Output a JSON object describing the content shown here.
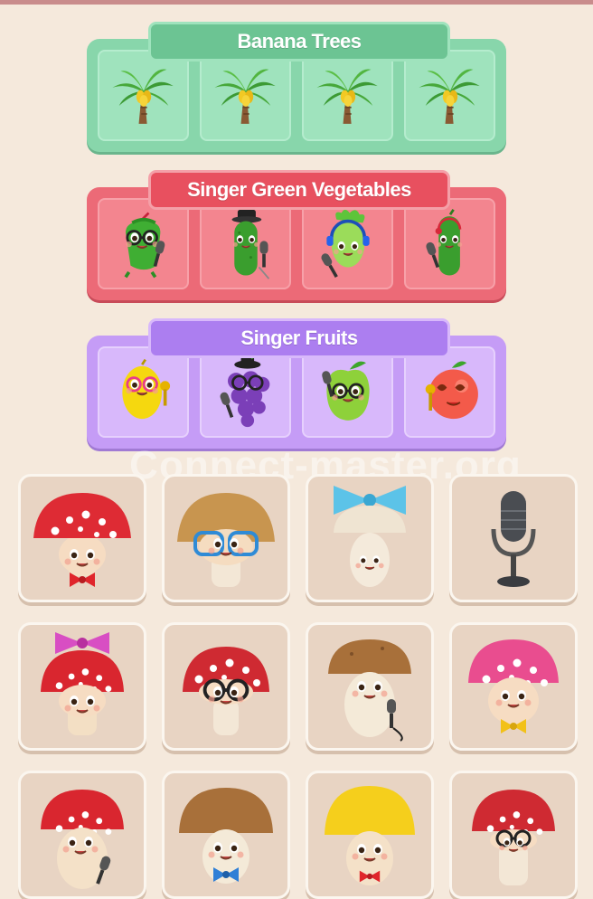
{
  "groups": [
    {
      "title": "Banana Trees",
      "items": [
        "banana-tree",
        "banana-tree",
        "banana-tree",
        "banana-tree"
      ]
    },
    {
      "title": "Singer Green Vegetables",
      "items": [
        "singing-pepper",
        "singing-cucumber-hat",
        "singing-celery",
        "singing-cucumber"
      ]
    },
    {
      "title": "Singer Fruits",
      "items": [
        "singing-lemon",
        "singing-grapes",
        "singing-apple",
        "singing-peach"
      ]
    }
  ],
  "watermark": "Connect-master.org",
  "tiles": [
    [
      "red-mushroom-bowtie",
      "glasses-mushroom",
      "bow-mushroom",
      "microphone"
    ],
    [
      "bow-red-mushroom",
      "glasses-red-mushroom",
      "brown-mushroom-microphone",
      "pink-mushroom-bowtie"
    ],
    [
      "red-mushroom-microphone",
      "brown-mushroom-bowtie",
      "yellow-mushroom",
      "red-mushroom-glasses"
    ]
  ],
  "colors": {
    "background": "#f5e9dc",
    "green": "#88d6ab",
    "red": "#ec6a77",
    "purple": "#c59cf6",
    "tile": "#e8d4c3"
  }
}
